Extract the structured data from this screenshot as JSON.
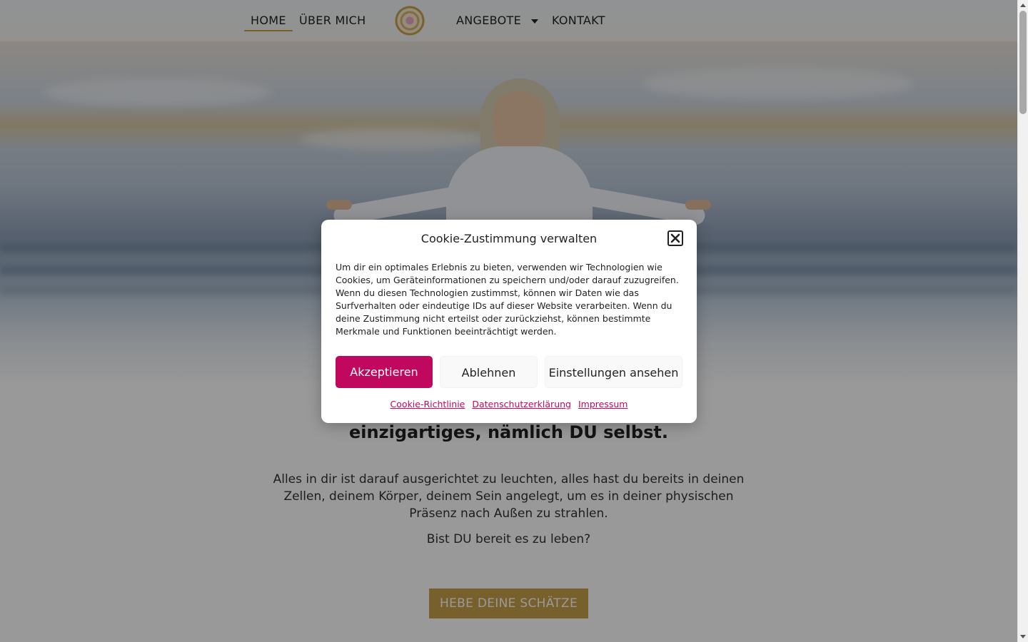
{
  "nav": {
    "items": [
      {
        "label": "HOME",
        "active": true
      },
      {
        "label": "ÜBER MICH"
      },
      {
        "label": "ANGEBOTE",
        "has_dropdown": true
      },
      {
        "label": "KONTAKT"
      }
    ],
    "logo_icon": "mandala-logo-icon"
  },
  "main": {
    "headline": "einzigartiges, nämlich DU selbst.",
    "paragraph": "Alles in dir ist darauf ausgerichtet zu leuchten, alles hast du bereits in deinen Zellen, deinem Körper, deinem Sein angelegt, um es in deiner physischen Präsenz nach Außen zu strahlen.",
    "question": "Bist DU bereit es zu leben?",
    "cta_label": "HEBE DEINE SCHÄTZE"
  },
  "cookie_dialog": {
    "title": "Cookie-Zustimmung verwalten",
    "body": "Um dir ein optimales Erlebnis zu bieten, verwenden wir Technologien wie Cookies, um Geräteinformationen zu speichern und/oder darauf zuzugreifen. Wenn du diesen Technologien zustimmst, können wir Daten wie das Surfverhalten oder eindeutige IDs auf dieser Website verarbeiten. Wenn du deine Zustimmung nicht erteilst oder zurückziehst, können bestimmte Merkmale und Funktionen beeinträchtigt werden.",
    "accept_label": "Akzeptieren",
    "deny_label": "Ablehnen",
    "settings_label": "Einstellungen ansehen",
    "links": [
      "Cookie-Richtlinie",
      "Datenschutzerklärung",
      "Impressum"
    ],
    "close_icon": "close-icon"
  },
  "colors": {
    "accent": "#c0095e",
    "gold": "#c9a14a"
  }
}
